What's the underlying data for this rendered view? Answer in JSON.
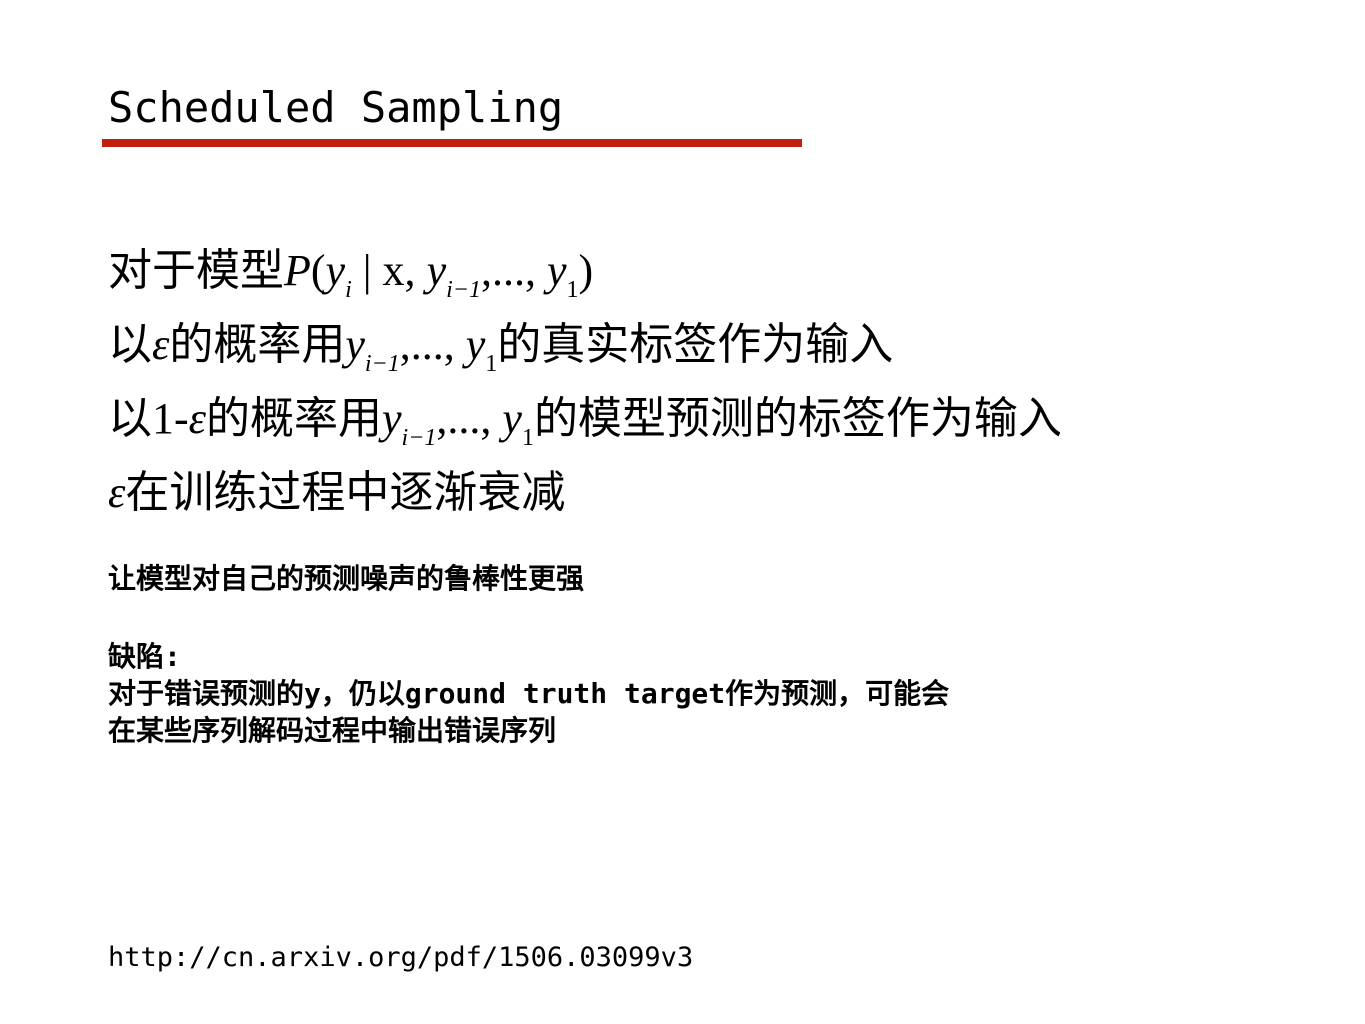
{
  "slide": {
    "title": "Scheduled Sampling",
    "accent_color": "#c0210e"
  },
  "formulas": {
    "line1": {
      "prefix": "对于模型",
      "model": "P",
      "open": "(",
      "y": "y",
      "sub_i": "i",
      "bar_x": " | x, ",
      "y_prev": "y",
      "sub_prev": "i−1",
      "ellipsis": ",..., ",
      "y_first": "y",
      "sub_first": "1",
      "close": ")"
    },
    "line2": {
      "prefix": "以",
      "epsilon": "ε",
      "middle": "的概率用",
      "y_prev": "y",
      "sub_prev": "i−1",
      "ellipsis": ",..., ",
      "y_first": "y",
      "sub_first": "1",
      "suffix": "的真实标签作为输入"
    },
    "line3": {
      "prefix": "以1-",
      "epsilon": "ε",
      "middle": "的概率用",
      "y_prev": "y",
      "sub_prev": "i−1",
      "ellipsis": ",..., ",
      "y_first": "y",
      "sub_first": "1",
      "suffix": "的模型预测的标签作为输入"
    },
    "line4": {
      "epsilon": "ε",
      "suffix": "在训练过程中逐渐衰减"
    }
  },
  "notes": {
    "robustness": "让模型对自己的预测噪声的鲁棒性更强",
    "drawback_label": "缺陷:",
    "drawback_line1": "对于错误预测的y，仍以ground truth target作为预测，可能会",
    "drawback_line2": "在某些序列解码过程中输出错误序列"
  },
  "reference": {
    "url": "http://cn.arxiv.org/pdf/1506.03099v3"
  }
}
